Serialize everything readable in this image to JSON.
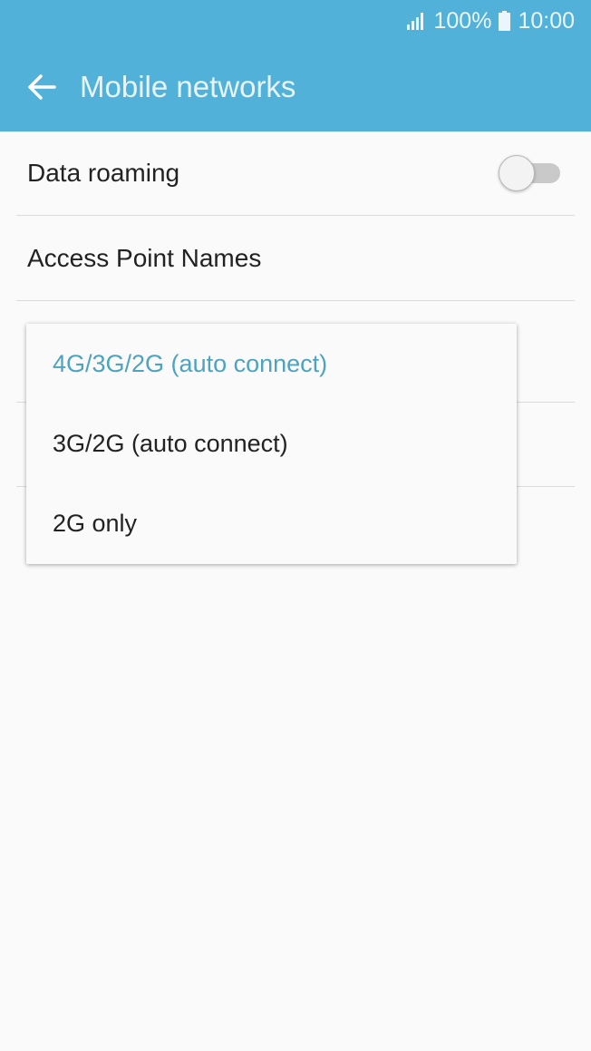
{
  "status_bar": {
    "signal_icon": "signal-icon",
    "battery_percent": "100%",
    "battery_icon": "battery-icon",
    "time": "10:00"
  },
  "app_bar": {
    "back_icon": "arrow-left-icon",
    "title": "Mobile networks"
  },
  "settings": {
    "data_roaming": {
      "label": "Data roaming",
      "enabled": false
    },
    "access_point_names": {
      "label": "Access Point Names"
    }
  },
  "network_mode_dropdown": {
    "options": [
      {
        "label": "4G/3G/2G (auto connect)",
        "selected": true
      },
      {
        "label": "3G/2G (auto connect)",
        "selected": false
      },
      {
        "label": "2G only",
        "selected": false
      }
    ]
  },
  "colors": {
    "header": "#52b1d8",
    "accent": "#4ea3bf",
    "background": "#fafafa"
  }
}
